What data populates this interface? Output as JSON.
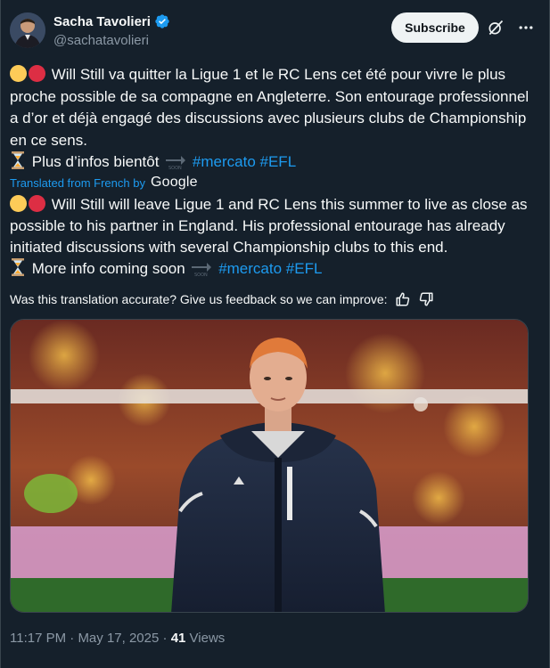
{
  "author": {
    "display_name": "Sacha Tavolieri",
    "handle": "@sachatavolieri",
    "verified": true
  },
  "actions": {
    "subscribe_label": "Subscribe",
    "grok_icon": "grok-icon",
    "more_icon": "more-icon"
  },
  "original": {
    "p1": "Will Still va quitter la Ligue 1 et le RC Lens cet été pour vivre le plus proche possible de sa compagne en Angleterre. Son entourage professionnel a d’or et déjà engagé des discussions avec plusieurs clubs de Championship en ce sens.",
    "p2": "Plus d’infos bientôt",
    "hashtag1": "#mercato",
    "hashtag2": "#EFL"
  },
  "translation_notice": {
    "label": "Translated from French by",
    "brand": "Google"
  },
  "translation": {
    "p1": "Will Still will leave Ligue 1 and RC Lens this summer to live as close as possible to his partner in England. His professional entourage has already initiated discussions with several Championship clubs to this end.",
    "p2": "More info coming soon",
    "hashtag1": "#mercato",
    "hashtag2": "#EFL"
  },
  "feedback": {
    "question": "Was this translation accurate? Give us feedback so we can improve:"
  },
  "meta": {
    "time": "11:17 PM",
    "separator": " · ",
    "date": "May 17, 2025",
    "views_count": "41",
    "views_label": " Views"
  },
  "colors": {
    "background": "#15202b",
    "link": "#1d9bf0",
    "secondary_text": "#8b98a5",
    "button_bg": "#eff3f4"
  }
}
